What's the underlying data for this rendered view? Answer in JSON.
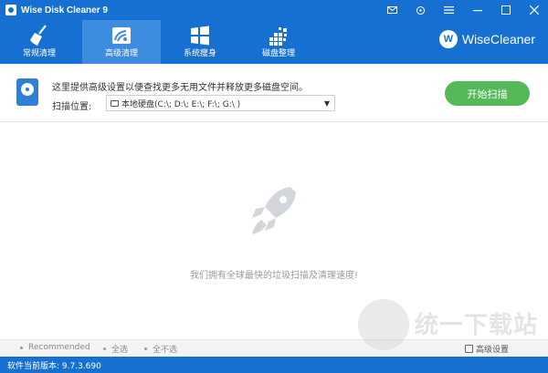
{
  "window": {
    "title": "Wise Disk Cleaner 9",
    "controls": [
      "mail-icon",
      "skin-icon",
      "menu-icon",
      "minimize-icon",
      "maximize-icon",
      "close-icon"
    ]
  },
  "nav": {
    "tabs": [
      {
        "label": "常规清理",
        "icon": "broom-icon",
        "active": false
      },
      {
        "label": "高级清理",
        "icon": "advanced-clean-icon",
        "active": true
      },
      {
        "label": "系统瘦身",
        "icon": "windows-icon",
        "active": false
      },
      {
        "label": "磁盘整理",
        "icon": "defrag-icon",
        "active": false
      }
    ],
    "brand": {
      "logo_letter": "W",
      "name": "WiseCleaner"
    }
  },
  "options": {
    "info": "这里提供高级设置以便查找更多无用文件并释放更多磁盘空间。",
    "scan_location_label": "扫描位置:",
    "scan_location_value": "本地硬盘(C:\\; D:\\; E:\\; F:\\; G:\\ )",
    "start_button": "开始扫描"
  },
  "main": {
    "message": "我们拥有全球最快的垃圾扫描及清理速度!"
  },
  "footer": {
    "recommended": "Recommended",
    "select_all": "全选",
    "select_none": "全不选",
    "advanced_settings": "高级设置"
  },
  "status": {
    "version_text": "软件当前版本: 9.7.3.690"
  },
  "watermark": {
    "text": "统一下载站"
  },
  "colors": {
    "primary": "#1670d1",
    "active_tab": "#3d8ce0",
    "start_button": "#54b958"
  }
}
